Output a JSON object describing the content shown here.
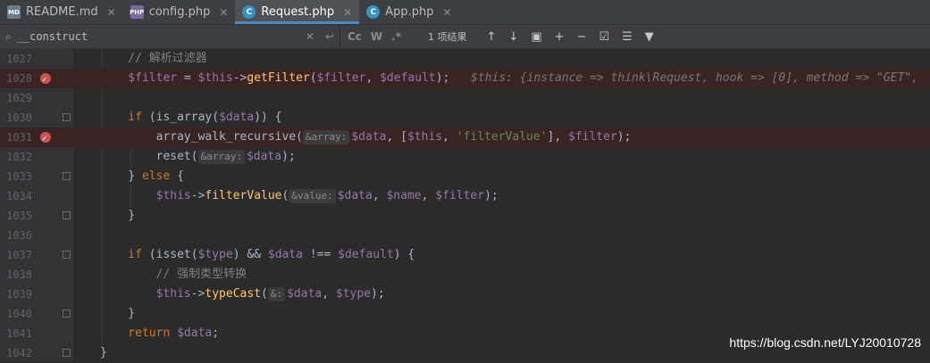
{
  "tabs": [
    {
      "label": "README.md",
      "icon": "MD",
      "type": "md",
      "active": false
    },
    {
      "label": "config.php",
      "icon": "PHP",
      "type": "php",
      "active": false
    },
    {
      "label": "Request.php",
      "icon": "C",
      "type": "cls",
      "active": true
    },
    {
      "label": "App.php",
      "icon": "C",
      "type": "cls",
      "active": false
    }
  ],
  "search": {
    "query": "__construct",
    "options": [
      "Cc",
      "W",
      ".*"
    ],
    "result_count": "1 项结果"
  },
  "code_lines": [
    {
      "num": "1027",
      "bp": false,
      "fold": false,
      "tokens": [
        [
          "cm",
          "    // 解析过滤器"
        ]
      ]
    },
    {
      "num": "1028",
      "bp": true,
      "fold": false,
      "tokens": [
        [
          "var",
          "    $filter"
        ],
        [
          "plain",
          " = "
        ],
        [
          "var",
          "$this"
        ],
        [
          "plain",
          "->"
        ],
        [
          "fn",
          "getFilter"
        ],
        [
          "plain",
          "("
        ],
        [
          "var",
          "$filter"
        ],
        [
          "plain",
          ", "
        ],
        [
          "var",
          "$default"
        ],
        [
          "plain",
          ");  "
        ],
        [
          "dbg",
          "$this: {instance => think\\Request, hook => [0], method => \"GET\","
        ]
      ]
    },
    {
      "num": "1029",
      "bp": false,
      "fold": false,
      "tokens": []
    },
    {
      "num": "1030",
      "bp": false,
      "fold": true,
      "tokens": [
        [
          "kw",
          "    if"
        ],
        [
          "plain",
          " (is_array("
        ],
        [
          "var",
          "$data"
        ],
        [
          "plain",
          ")) {"
        ]
      ]
    },
    {
      "num": "1031",
      "bp": true,
      "fold": false,
      "tokens": [
        [
          "plain",
          "        array_walk_recursive("
        ],
        [
          "hint",
          "&array:"
        ],
        [
          "var",
          "$data"
        ],
        [
          "plain",
          ", ["
        ],
        [
          "var",
          "$this"
        ],
        [
          "plain",
          ", "
        ],
        [
          "str",
          "'filterValue'"
        ],
        [
          "plain",
          "], "
        ],
        [
          "var",
          "$filter"
        ],
        [
          "plain",
          ");"
        ]
      ]
    },
    {
      "num": "1032",
      "bp": false,
      "fold": false,
      "tokens": [
        [
          "plain",
          "        reset("
        ],
        [
          "hint",
          "&array:"
        ],
        [
          "var",
          "$data"
        ],
        [
          "plain",
          ");"
        ]
      ]
    },
    {
      "num": "1033",
      "bp": false,
      "fold": true,
      "tokens": [
        [
          "plain",
          "    } "
        ],
        [
          "kw",
          "else"
        ],
        [
          "plain",
          " {"
        ]
      ]
    },
    {
      "num": "1034",
      "bp": false,
      "fold": false,
      "tokens": [
        [
          "var",
          "        $this"
        ],
        [
          "plain",
          "->"
        ],
        [
          "fn",
          "filterValue"
        ],
        [
          "plain",
          "("
        ],
        [
          "hint",
          "&value:"
        ],
        [
          "var",
          "$data"
        ],
        [
          "plain",
          ", "
        ],
        [
          "var",
          "$name"
        ],
        [
          "plain",
          ", "
        ],
        [
          "var",
          "$filter"
        ],
        [
          "plain",
          ");"
        ]
      ]
    },
    {
      "num": "1035",
      "bp": false,
      "fold": true,
      "tokens": [
        [
          "plain",
          "    }"
        ]
      ]
    },
    {
      "num": "1036",
      "bp": false,
      "fold": false,
      "tokens": []
    },
    {
      "num": "1037",
      "bp": false,
      "fold": true,
      "tokens": [
        [
          "kw",
          "    if"
        ],
        [
          "plain",
          " (isset("
        ],
        [
          "var",
          "$type"
        ],
        [
          "plain",
          ") && "
        ],
        [
          "var",
          "$data"
        ],
        [
          "plain",
          " !== "
        ],
        [
          "var",
          "$default"
        ],
        [
          "plain",
          ") {"
        ]
      ]
    },
    {
      "num": "1038",
      "bp": false,
      "fold": false,
      "tokens": [
        [
          "cm",
          "        // 强制类型转换"
        ]
      ]
    },
    {
      "num": "1039",
      "bp": false,
      "fold": false,
      "tokens": [
        [
          "var",
          "        $this"
        ],
        [
          "plain",
          "->"
        ],
        [
          "fn",
          "typeCast"
        ],
        [
          "plain",
          "("
        ],
        [
          "hint",
          "&:"
        ],
        [
          "var",
          "$data"
        ],
        [
          "plain",
          ", "
        ],
        [
          "var",
          "$type"
        ],
        [
          "plain",
          ");"
        ]
      ]
    },
    {
      "num": "1040",
      "bp": false,
      "fold": true,
      "tokens": [
        [
          "plain",
          "    }"
        ]
      ]
    },
    {
      "num": "1041",
      "bp": false,
      "fold": false,
      "tokens": [
        [
          "kw",
          "    return"
        ],
        [
          "plain",
          " "
        ],
        [
          "var",
          "$data"
        ],
        [
          "plain",
          ";"
        ]
      ]
    },
    {
      "num": "1042",
      "bp": false,
      "fold": true,
      "tokens": [
        [
          "plain",
          "}"
        ]
      ]
    }
  ],
  "watermark": "https://blog.csdn.net/LYJ20010728"
}
